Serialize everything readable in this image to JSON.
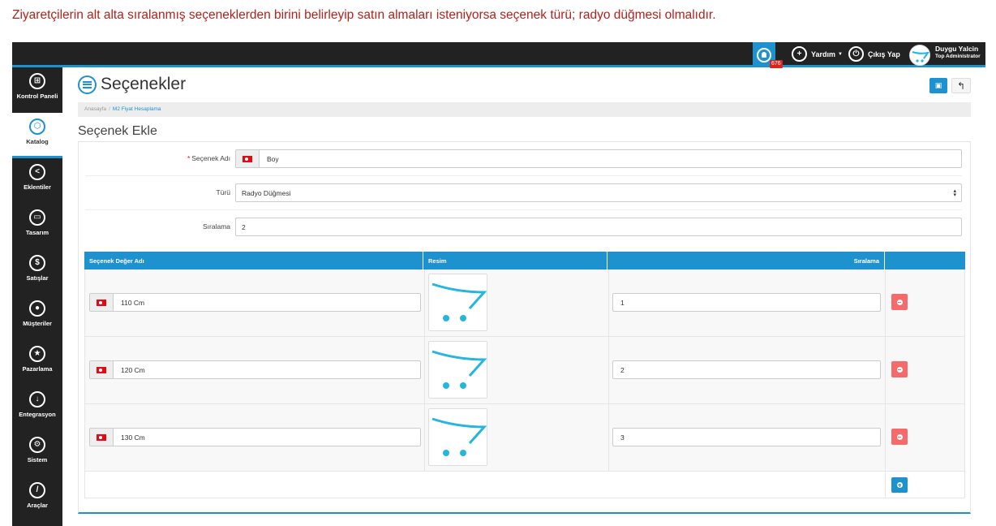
{
  "caption": "Ziyaretçilerin alt alta sıralanmış seçeneklerden birini belirleyip satın almaları isteniyorsa seçenek türü; radyo düğmesi olmalıdır.",
  "header": {
    "notification_count": "676",
    "help_label": "Yardım",
    "logout_label": "Çıkış Yap",
    "user_name": "Duygu Yalcin",
    "user_role": "Top Administrator"
  },
  "sidebar": {
    "items": [
      {
        "label": "Kontrol Paneli",
        "icon": "dashboard-icon"
      },
      {
        "label": "Katalog",
        "icon": "catalog-icon",
        "active": true
      },
      {
        "label": "Eklentiler",
        "icon": "extensions-icon"
      },
      {
        "label": "Tasarım",
        "icon": "design-icon"
      },
      {
        "label": "Satışlar",
        "icon": "dollar-icon"
      },
      {
        "label": "Müşteriler",
        "icon": "user-icon"
      },
      {
        "label": "Pazarlama",
        "icon": "star-icon"
      },
      {
        "label": "Entegrasyon",
        "icon": "download-icon"
      },
      {
        "label": "Sistem",
        "icon": "cogs-icon"
      },
      {
        "label": "Araçlar",
        "icon": "wrench-icon"
      }
    ]
  },
  "page": {
    "title": "Seçenekler",
    "breadcrumb": [
      "Anasayfa",
      "M2 Fiyat Hesaplama"
    ],
    "subtitle": "Seçenek Ekle"
  },
  "form": {
    "name_label": "Seçenek Adı",
    "name_value": "Boy",
    "type_label": "Türü",
    "type_value": "Radyo Düğmesi",
    "sort_label": "Sıralama",
    "sort_value": "2"
  },
  "table": {
    "headers": [
      "Seçenek Değer Adı",
      "Resim",
      "Sıralama"
    ],
    "rows": [
      {
        "name": "110 Cm",
        "sort": "1"
      },
      {
        "name": "120 Cm",
        "sort": "2"
      },
      {
        "name": "130 Cm",
        "sort": "3"
      }
    ]
  },
  "colors": {
    "accent": "#1e91cf",
    "danger": "#f56b6b",
    "caption": "#b3211b",
    "sidebar": "#222222"
  }
}
